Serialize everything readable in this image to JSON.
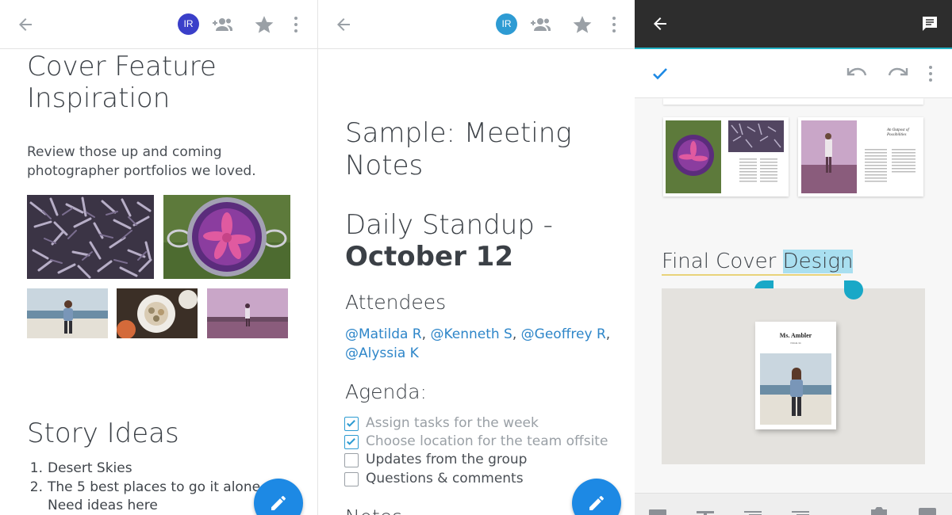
{
  "colors": {
    "accent_blue": "#1d89e4",
    "mention_blue": "#2e86c9",
    "selection_teal": "#23b3c5",
    "avatar_navy": "#3a3fc9",
    "avatar_teal": "#2e9bd3"
  },
  "panel1": {
    "avatar_initials": "IR",
    "title_line1": "Cover Feature",
    "title_line2": "Inspiration",
    "intro_line1": "Review those up and coming",
    "intro_line2": "photographer portfolios we loved.",
    "story_heading": "Story Ideas",
    "story_items": [
      {
        "num": "1.",
        "text": "Desert Skies"
      },
      {
        "num": "2.",
        "text": "The 5 best places to go it alone"
      },
      {
        "num": "",
        "text": "Need ideas here"
      }
    ],
    "fab_icon": "pencil-icon"
  },
  "panel2": {
    "avatar_initials": "IR",
    "title_line1": "Sample: Meeting",
    "title_line2": "Notes",
    "standup_line1": "Daily Standup -",
    "standup_line2": "October 12",
    "attendees_heading": "Attendees",
    "attendees": [
      "@Matilda R",
      "@Kenneth S",
      "@Geoffrey R",
      "@Alyssia K"
    ],
    "agenda_heading": "Agenda:",
    "agenda_items": [
      {
        "text": "Assign tasks for the week",
        "checked": true
      },
      {
        "text": "Choose location for the team offsite",
        "checked": true
      },
      {
        "text": "Updates from the group",
        "checked": false
      },
      {
        "text": "Questions & comments",
        "checked": false
      }
    ],
    "partial_heading": "Notes",
    "fab_icon": "pencil-icon"
  },
  "panel3": {
    "heading_plain": "Final Cover ",
    "heading_selected": "Design",
    "magazine_title": "Ms. Ambler",
    "magazine_subtitle": "ISSUE 34",
    "spread_title": "An Outpost of Possibilities",
    "icons": [
      "back-arrow-icon",
      "comment-icon",
      "checkmark-icon",
      "undo-icon",
      "redo-icon",
      "more-vert-icon"
    ]
  }
}
